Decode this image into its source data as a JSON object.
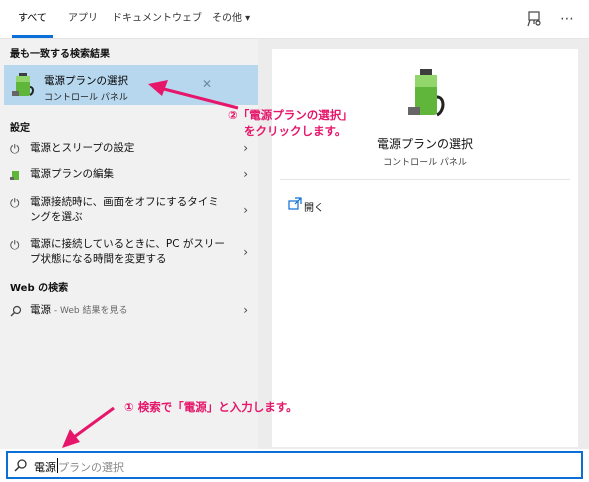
{
  "tabs": [
    {
      "label": "すべて"
    },
    {
      "label": "アプリ"
    },
    {
      "label": "ドキュメント"
    },
    {
      "label": "ウェブ"
    },
    {
      "label": "その他 ▾"
    }
  ],
  "left": {
    "best_match_header": "最も一致する検索結果",
    "best_match": {
      "title": "電源プランの選択",
      "subtitle": "コントロール パネル"
    },
    "settings_header": "設定",
    "settings": [
      {
        "label": "電源とスリープの設定"
      },
      {
        "label": "電源プランの編集"
      },
      {
        "label": "電源接続時に、画面をオフにするタイミングを選ぶ"
      },
      {
        "label": "電源に接続しているときに、PC がスリープ状態になる時間を変更する"
      }
    ],
    "web_header": "Web の検索",
    "web_item": {
      "term": "電源",
      "suffix": " - Web 結果を見る"
    }
  },
  "right": {
    "title": "電源プランの選択",
    "subtitle": "コントロール パネル",
    "open_label": "開く"
  },
  "search": {
    "typed": "電源",
    "suggestion": "プランの選択"
  },
  "annotations": {
    "step2_line1": "②「電源プランの選択」",
    "step2_line2": "をクリックします。",
    "step1": "① 検索で「電源」と入力します。"
  },
  "colors": {
    "accent": "#0a6fd6",
    "annotation": "#e6166a",
    "highlight": "#b7d7ee"
  }
}
